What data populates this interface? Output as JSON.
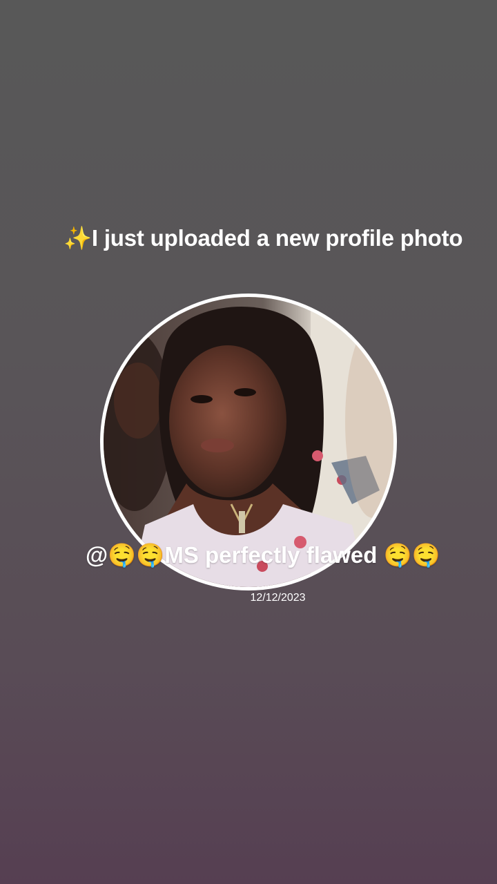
{
  "post": {
    "headline": "✨I just uploaded a new profile photo",
    "caption": "@🤤🤤MS perfectly flawed 🤤🤤",
    "date": "12/12/2023"
  },
  "avatar": {
    "icon": "profile-photo"
  }
}
